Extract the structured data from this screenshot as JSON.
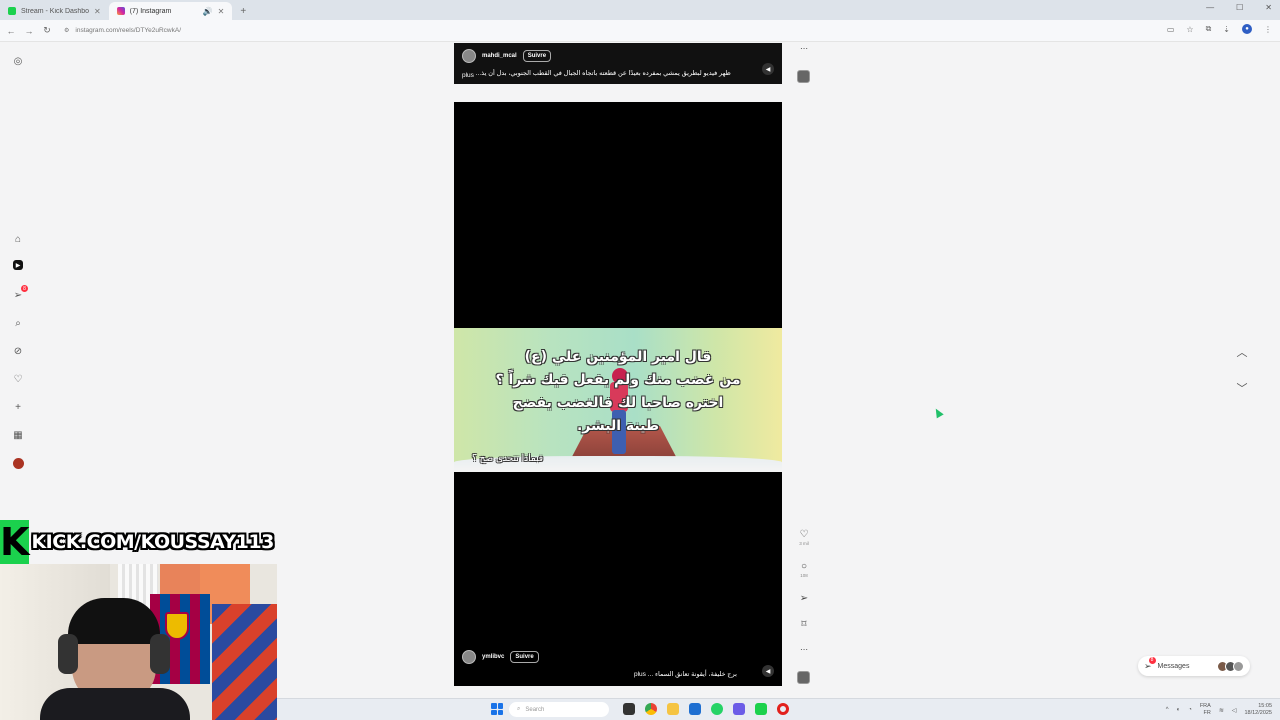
{
  "browser": {
    "tabs": [
      {
        "label": "Stream - Kick Dashboard",
        "active": false
      },
      {
        "label": "(7) Instagram",
        "active": true
      }
    ],
    "new_tab": "+",
    "url": "instagram.com/reels/DTYe2uRcwkA/",
    "window_controls": [
      "—",
      "☐",
      "✕"
    ]
  },
  "reel_top": {
    "username": "mahdi_mcal",
    "follow_label": "Suivre",
    "caption": "ظهر فيديو لبطريق يمشي بمفرده بعيدًا عن قطعته باتجاه الجبال في القطب الجنوبي، بدل أن يذ...",
    "more_label": "plus"
  },
  "reel_main": {
    "overlay_lines": [
      "قال امير المؤمنين علي (ع)",
      "من غضب منك ولم يفعل فيك شراً ؟",
      "اختره صاحبا لك فالغضب يفضح",
      "طينة البشر."
    ],
    "overlay_sub": "فبماذا تتحدى صح ؟",
    "username": "ymlibvc",
    "follow_label": "Suivre",
    "caption": "برج خليفة، أيقونة تعانق السماء ...",
    "more_label": "plus"
  },
  "actions": {
    "like_count": "3 mil",
    "comment_count": "108"
  },
  "left_nav": {
    "notifications_badge": "8"
  },
  "messages": {
    "label": "Messages",
    "badge": "8"
  },
  "stream": {
    "kick_logo": "K",
    "kick_url": "KICK.COM/KOUSSAY113"
  },
  "taskbar": {
    "search_placeholder": "Search",
    "lang_line1": "FRA",
    "lang_line2": "FR",
    "time": "15:05",
    "date": "18/12/2025"
  },
  "colors": {
    "kick_green": "#1bd14d",
    "ig_badge_red": "#ff3040"
  }
}
